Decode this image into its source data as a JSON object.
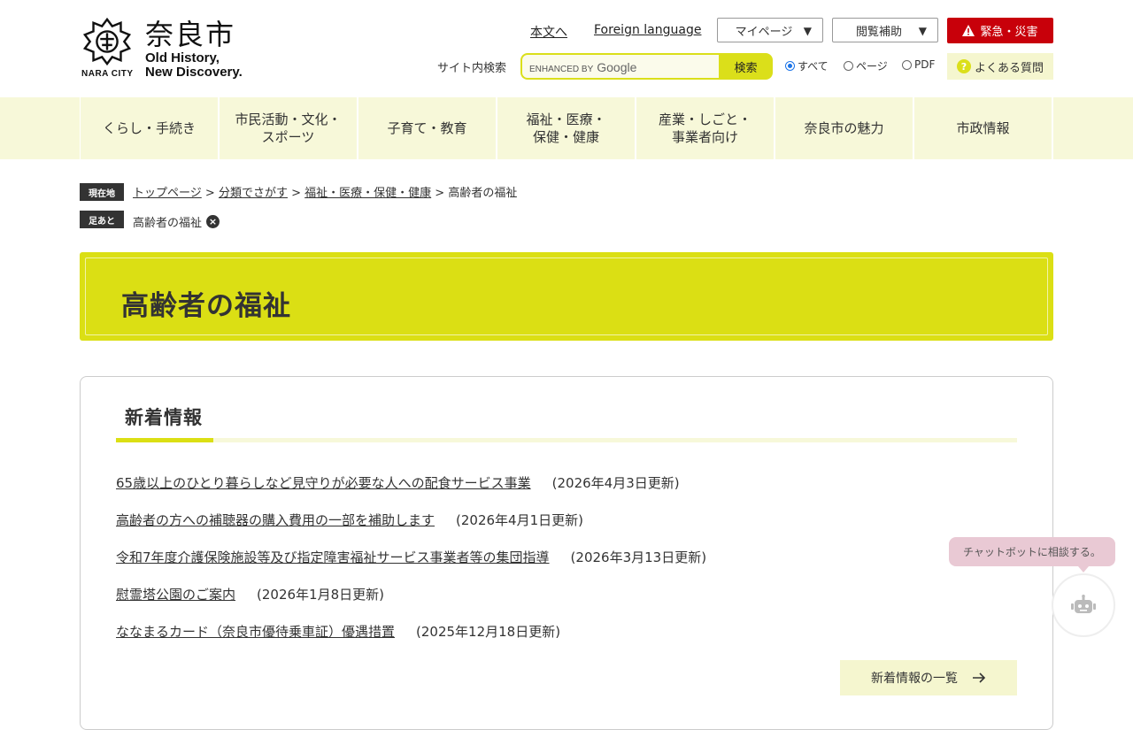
{
  "header": {
    "logo_name": "奈良市",
    "logo_tagline_1": "Old History,",
    "logo_tagline_2": "New Discovery.",
    "logo_city": "NARA CITY",
    "skip_link": "本文へ",
    "foreign_link": "Foreign language",
    "mypage_label": "マイページ",
    "accessibility_label": "閲覧補助",
    "emergency_label": "緊急・災害",
    "search_label": "サイト内検索",
    "search_enhanced": "ENHANCED BY",
    "search_google": "Google",
    "search_button": "検索",
    "radio_all": "すべて",
    "radio_page": "ページ",
    "radio_pdf": "PDF",
    "faq_label": "よくある質問"
  },
  "nav": {
    "items": [
      "くらし・手続き",
      "市民活動・文化・\nスポーツ",
      "子育て・教育",
      "福祉・医療・\n保健・健康",
      "産業・しごと・\n事業者向け",
      "奈良市の魅力",
      "市政情報"
    ]
  },
  "breadcrumb": {
    "current_tag": "現在地",
    "links": [
      "トップページ",
      "分類でさがす",
      "福祉・医療・保健・健康"
    ],
    "current": "高齢者の福祉",
    "separator": ">",
    "trail_tag": "足あと",
    "trail_item": "高齢者の福祉"
  },
  "page": {
    "title": "高齢者の福祉"
  },
  "news": {
    "heading": "新着情報",
    "items": [
      {
        "title": "65歳以上のひとり暮らしなど見守りが必要な人への配食サービス事業",
        "date": "(2026年4月3日更新)"
      },
      {
        "title": "高齢者の方への補聴器の購入費用の一部を補助します",
        "date": "(2026年4月1日更新)"
      },
      {
        "title": "令和7年度介護保険施設等及び指定障害福祉サービス事業者等の集団指導",
        "date": "(2026年3月13日更新)"
      },
      {
        "title": "慰霊塔公園のご案内",
        "date": "(2026年1月8日更新)"
      },
      {
        "title": "ななまるカード（奈良市優待乗車証）優遇措置",
        "date": "(2025年12月18日更新)"
      }
    ],
    "more_label": "新着情報の一覧"
  },
  "chatbot": {
    "bubble": "チャットボットに相談する。"
  },
  "colors": {
    "accent": "#dbdf14",
    "accent_light": "#f7f8d9",
    "emergency": "#c8000a"
  }
}
